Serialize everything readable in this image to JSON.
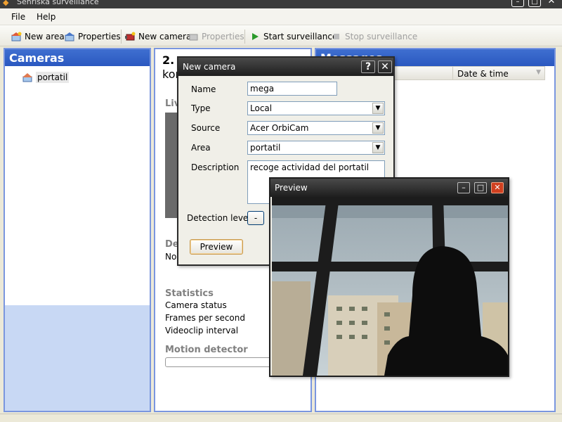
{
  "window": {
    "title": "Senriska surveillance"
  },
  "menu": {
    "file": "File",
    "help": "Help"
  },
  "toolbar": {
    "new_area": "New area",
    "properties_area": "Properties",
    "new_camera": "New camera",
    "properties_camera": "Properties",
    "start_surveillance": "Start surveillance",
    "stop_surveillance": "Stop surveillance"
  },
  "cameras_pane": {
    "title": "Cameras",
    "items": [
      {
        "label": "portatil"
      }
    ]
  },
  "details_pane": {
    "title_line1": "2. c",
    "title_line2": "kor",
    "live_label": "Liv",
    "desc_label": "De",
    "desc_value": "No",
    "statistics_title": "Statistics",
    "camera_status": "Camera status",
    "fps": "Frames per second",
    "videoclip_interval": "Videoclip interval",
    "motion_detector": "Motion detector"
  },
  "messages_pane": {
    "title": "Messages",
    "column_date": "Date & time"
  },
  "new_camera_dialog": {
    "title": "New camera",
    "help_btn": "?",
    "close_btn": "✕",
    "name_label": "Name",
    "name_value": "mega",
    "type_label": "Type",
    "type_value": "Local",
    "source_label": "Source",
    "source_value": "Acer OrbiCam",
    "area_label": "Area",
    "area_value": "portatil",
    "description_label": "Description",
    "description_value": "recoge actividad del portatil",
    "detection_label": "Detection level",
    "detection_btn": "-",
    "preview_btn": "Preview"
  },
  "preview_window": {
    "title": "Preview"
  }
}
